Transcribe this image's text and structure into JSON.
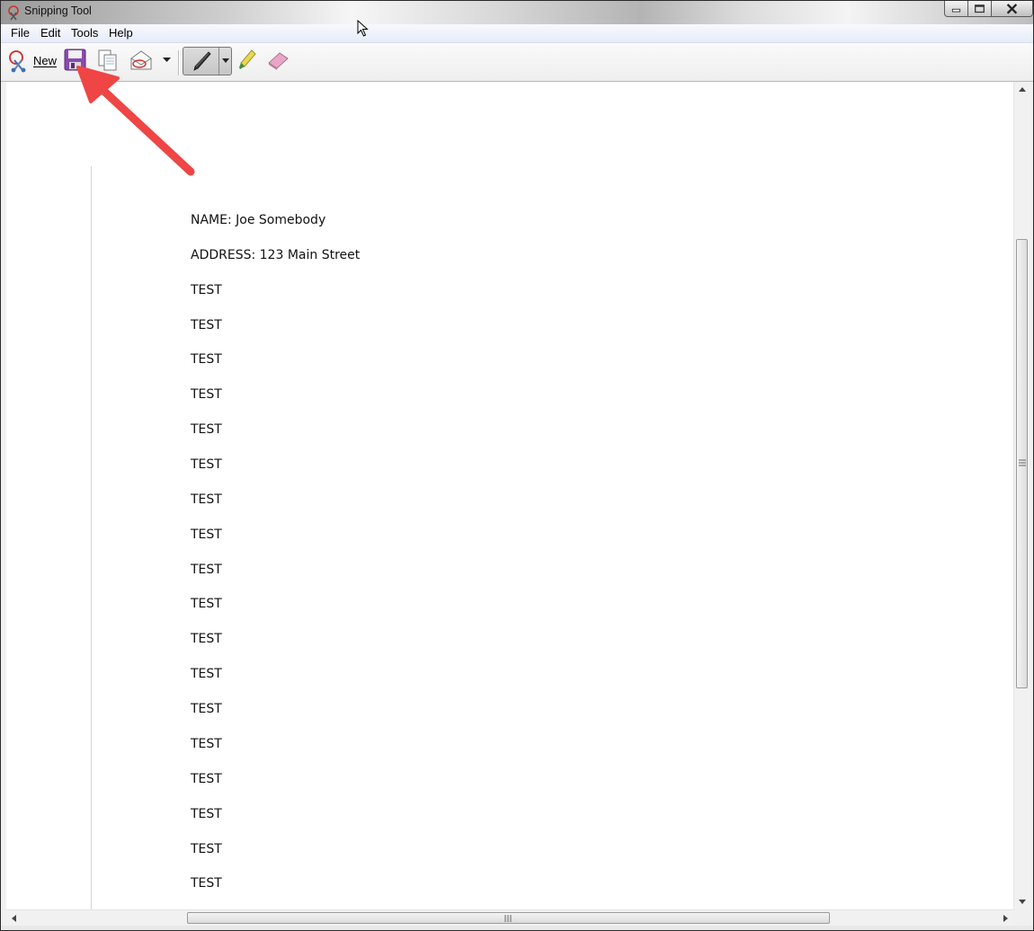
{
  "window": {
    "title": "Snipping Tool"
  },
  "menu": [
    "File",
    "Edit",
    "Tools",
    "Help"
  ],
  "toolbar": {
    "new_label": "New"
  },
  "document": {
    "lines": [
      "NAME: Joe Somebody",
      "ADDRESS: 123 Main Street",
      "TEST",
      "TEST",
      "TEST",
      "TEST",
      "TEST",
      "TEST",
      "TEST",
      "TEST",
      "TEST",
      "TEST",
      "TEST",
      "TEST",
      "TEST",
      "TEST",
      "TEST",
      "TEST",
      "TEST",
      "TEST"
    ]
  },
  "colors": {
    "annotation_arrow": "#ef4545",
    "save_icon": "#7b3f9e"
  }
}
